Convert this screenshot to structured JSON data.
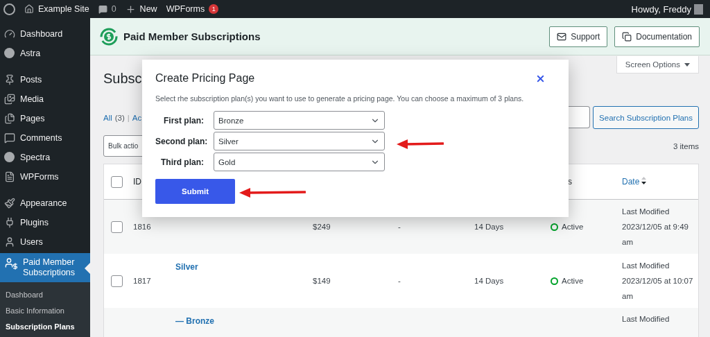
{
  "admin_bar": {
    "site": "Example Site",
    "comments": "0",
    "new": "New",
    "forms": "WPForms",
    "forms_badge": "1",
    "greeting": "Howdy, Freddy"
  },
  "sidebar": {
    "groups": [
      {
        "items": [
          {
            "label": "Dashboard"
          },
          {
            "label": "Astra"
          }
        ]
      },
      {
        "items": [
          {
            "label": "Posts"
          },
          {
            "label": "Media"
          },
          {
            "label": "Pages"
          },
          {
            "label": "Comments"
          },
          {
            "label": "Spectra"
          },
          {
            "label": "WPForms"
          }
        ]
      },
      {
        "items": [
          {
            "label": "Appearance"
          },
          {
            "label": "Plugins"
          },
          {
            "label": "Users"
          }
        ]
      }
    ],
    "active": {
      "label": "Paid Member Subscriptions"
    },
    "submenu": [
      {
        "label": "Dashboard",
        "selected": false
      },
      {
        "label": "Basic Information",
        "selected": false
      },
      {
        "label": "Subscription Plans",
        "selected": true
      }
    ]
  },
  "plugin_header": {
    "title": "Paid Member Subscriptions",
    "buttons": [
      "Support",
      "Documentation"
    ]
  },
  "screen_options": "Screen Options",
  "page": {
    "heading": "Subsc",
    "filters": [
      {
        "label": "All",
        "count": "(3)"
      },
      {
        "label": "Ac"
      }
    ],
    "separator": "|",
    "search_button": "Search Subscription Plans",
    "bulk_actions": "Bulk actio",
    "items_count": "3 items"
  },
  "table": {
    "select_all": {
      "checked": false
    },
    "columns": [
      {
        "label": "ID"
      },
      {
        "label": "s"
      },
      {
        "label": "Date"
      }
    ],
    "rows": [
      {
        "checked": false,
        "id": "1816",
        "price": "$249",
        "column_5": "-",
        "trial": "14 Days",
        "status": "Active",
        "date": "Last Modified 2023/12/05 at 9:49 am"
      },
      {
        "checked": false,
        "id": "1817",
        "name": "Silver",
        "price": "$149",
        "column_5": "-",
        "trial": "14 Days",
        "status": "Active",
        "date": "Last Modified 2023/12/05 at 10:07 am"
      },
      {
        "name": "— Bronze",
        "date": "Last Modified"
      }
    ]
  },
  "modal": {
    "title": "Create Pricing Page",
    "description": "Select rhe subscription plan(s) you want to use to generate a pricing page. You can choose a maximum of 3 plans.",
    "fields": [
      {
        "label": "First plan:",
        "value": "Bronze"
      },
      {
        "label": "Second plan:",
        "value": "Silver"
      },
      {
        "label": "Third plan:",
        "value": "Gold"
      }
    ],
    "submit": "Submit"
  }
}
